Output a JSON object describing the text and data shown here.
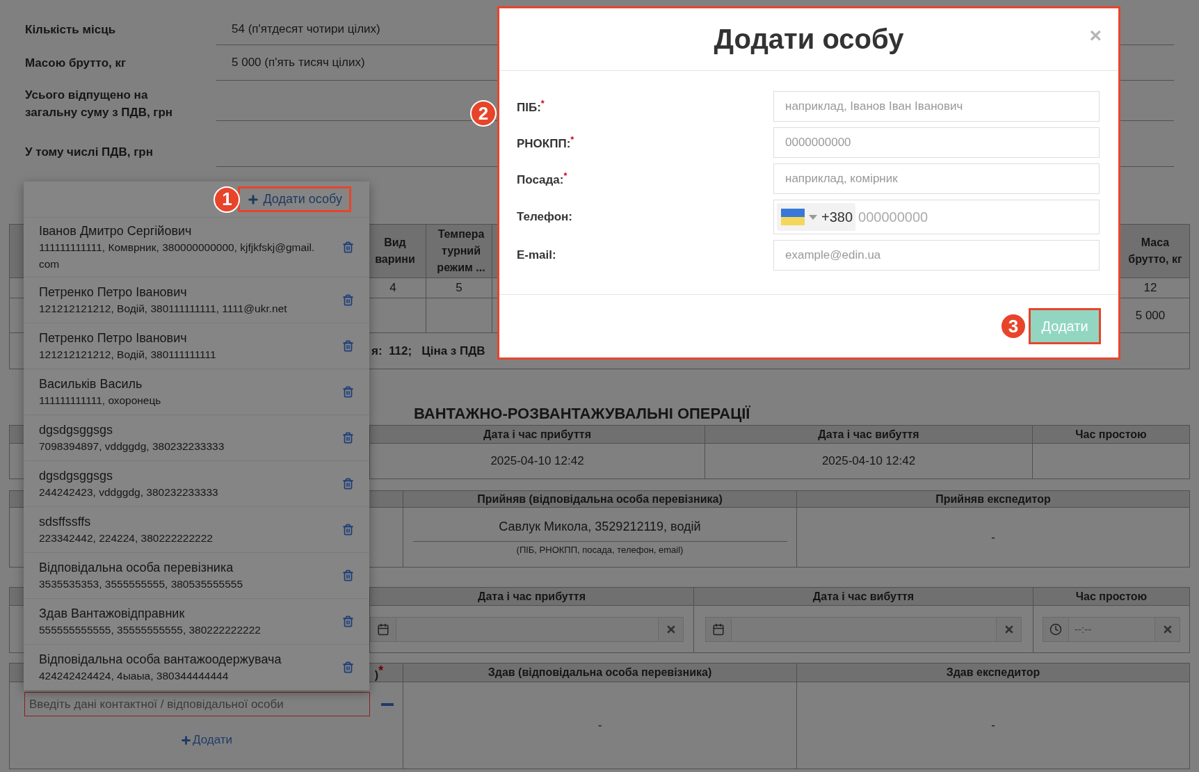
{
  "summary": [
    {
      "label": "Кількість місць",
      "value": "54 (п'ятдесят чотири цілих)"
    },
    {
      "label": "Масою брутто, кг",
      "value": "5 000 (п'ять тисяч цілих)"
    },
    {
      "label": "Усього відпущено на загальну суму з ПДВ, грн"
    },
    {
      "label": "У тому числі ПДВ, грн"
    }
  ],
  "goods_table": {
    "headers": [
      "Вид варини",
      "Темпера турний режим ...",
      "Маса брутто, кг"
    ],
    "column_numbers": [
      "4",
      "5",
      "12"
    ],
    "gross_mass": "5 000",
    "totals": "я:  112;   Ціна з ПДВ"
  },
  "operations": {
    "title": "ВАНТАЖНО-РОЗВАНТАЖУВАЛЬНІ ОПЕРАЦІЇ",
    "loading_times": {
      "headers": [
        "Дата і час прибуття",
        "Дата і час вибуття",
        "Час простою"
      ],
      "values": [
        "2025-04-10 12:42",
        "2025-04-10 12:42"
      ]
    },
    "loading_acceptance": {
      "headers": [
        "Прийняв (відповідальна особа перевізника)",
        "Прийняв експедитор"
      ],
      "carrier_person": "Савлук Микола, 3529212119, водій",
      "carrier_hint": "(ПІБ, РНОКПП, посада, телефон, email)",
      "forwarder": "-"
    },
    "unloading_times": {
      "headers": [
        "Дата і час прибуття",
        "Дата і час вибуття",
        "Час простою"
      ],
      "idle_placeholder": "--:--"
    },
    "unloading_handover": {
      "headers": [
        ")$^{*}$",
        "Здав (відповідальна особа перевізника)",
        "Здав експедитор"
      ],
      "contact_placeholder": "Введіть дані контактної / відповідальної особи",
      "add_link": "Додати",
      "carrier": "-",
      "forwarder": "-"
    }
  },
  "person_dropdown": {
    "add_button": "Додати особу",
    "badge": "1",
    "persons": [
      {
        "name": "Іванов Дмитро Сергійович",
        "details": "111111111111, Комврник, 380000000000, kjfjkfskj@gmail.com"
      },
      {
        "name": "Петренко Петро Іванович",
        "details": "121212121212, Водій, 380111111111, 1111@ukr.net"
      },
      {
        "name": "Петренко Петро Іванович",
        "details": "121212121212, Водій, 380111111111"
      },
      {
        "name": "Васильків Василь",
        "details": "111111111111, охоронець"
      },
      {
        "name": "dgsdgsggsgs",
        "details": "7098394897, vddggdg, 380232233333"
      },
      {
        "name": "dgsdgsggsgs",
        "details": "244242423, vddggdg, 380232233333"
      },
      {
        "name": "sdsffssffs",
        "details": "223342442, 224224, 380222222222"
      },
      {
        "name": "Відповідальна особа перевізника",
        "details": "3535535353, 3555555555, 380535555555"
      },
      {
        "name": "Здав Вантажовідправник",
        "details": "555555555555, 35555555555, 380222222222"
      },
      {
        "name": "Відповідальна особа вантажоодержувача",
        "details": "424242424424, 4ыаыа, 380344444444"
      }
    ]
  },
  "modal": {
    "title": "Додати особу",
    "close": "×",
    "badge": "2",
    "fields": [
      {
        "kind": "text",
        "label": "ПІБ:$^{*}$",
        "placeholder": "наприклад, Іванов Іван Іванович"
      },
      {
        "kind": "text",
        "label": "РНОКПП:$^{*}$",
        "placeholder": "0000000000"
      },
      {
        "kind": "text",
        "label": "Посада:$^{*}$",
        "placeholder": "наприклад, комірник"
      },
      {
        "kind": "phone",
        "label": "Телефон:",
        "dial_code": "+380",
        "placeholder": "000000000"
      },
      {
        "kind": "text",
        "label": "E-mail:",
        "placeholder": "example@edin.ua"
      }
    ],
    "submit": "Додати",
    "submit_badge": "3"
  }
}
